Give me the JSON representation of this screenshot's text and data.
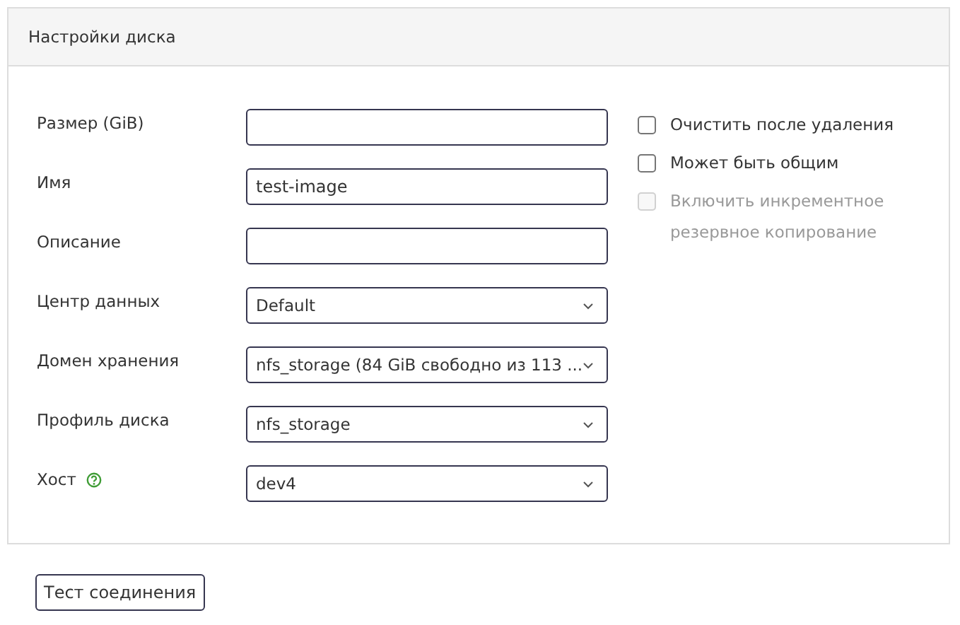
{
  "panel": {
    "title": "Настройки диска"
  },
  "fields": [
    {
      "label": "Размер (GiB)",
      "kind": "text"
    },
    {
      "label": "Имя",
      "kind": "text",
      "value": "test-image"
    },
    {
      "label": "Описание",
      "kind": "text"
    },
    {
      "label": "Центр данных",
      "kind": "select",
      "value": "Default"
    },
    {
      "label": "Домен хранения",
      "kind": "select",
      "value": "nfs_storage (84 GiB свободно из 113 ..."
    },
    {
      "label": "Профиль диска",
      "kind": "select",
      "value": "nfs_storage"
    },
    {
      "label": "Хост",
      "kind": "select",
      "value": "dev4",
      "help": true
    }
  ],
  "options": [
    {
      "label": "Очистить после удаления",
      "checked": false,
      "disabled": false
    },
    {
      "label": "Может быть общим",
      "checked": false,
      "disabled": false
    },
    {
      "label": "Включить инкрементное резервное копирование",
      "checked": false,
      "disabled": true
    }
  ],
  "buttons": [
    "Тест соединения"
  ]
}
